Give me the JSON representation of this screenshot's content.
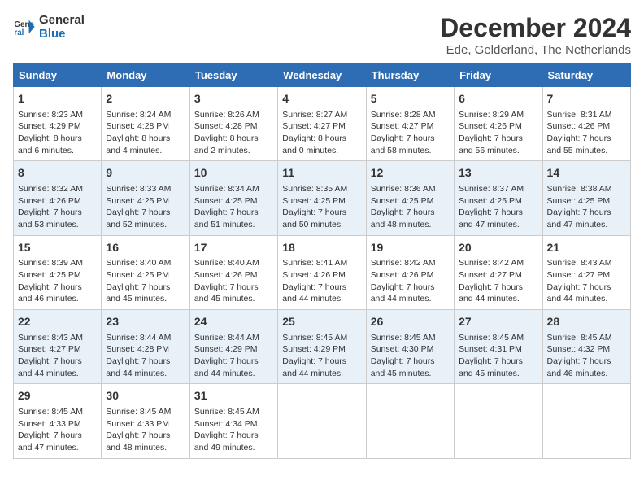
{
  "logo": {
    "line1": "General",
    "line2": "Blue"
  },
  "title": "December 2024",
  "subtitle": "Ede, Gelderland, The Netherlands",
  "columns": [
    "Sunday",
    "Monday",
    "Tuesday",
    "Wednesday",
    "Thursday",
    "Friday",
    "Saturday"
  ],
  "weeks": [
    [
      {
        "day": "1",
        "info": "Sunrise: 8:23 AM\nSunset: 4:29 PM\nDaylight: 8 hours\nand 6 minutes."
      },
      {
        "day": "2",
        "info": "Sunrise: 8:24 AM\nSunset: 4:28 PM\nDaylight: 8 hours\nand 4 minutes."
      },
      {
        "day": "3",
        "info": "Sunrise: 8:26 AM\nSunset: 4:28 PM\nDaylight: 8 hours\nand 2 minutes."
      },
      {
        "day": "4",
        "info": "Sunrise: 8:27 AM\nSunset: 4:27 PM\nDaylight: 8 hours\nand 0 minutes."
      },
      {
        "day": "5",
        "info": "Sunrise: 8:28 AM\nSunset: 4:27 PM\nDaylight: 7 hours\nand 58 minutes."
      },
      {
        "day": "6",
        "info": "Sunrise: 8:29 AM\nSunset: 4:26 PM\nDaylight: 7 hours\nand 56 minutes."
      },
      {
        "day": "7",
        "info": "Sunrise: 8:31 AM\nSunset: 4:26 PM\nDaylight: 7 hours\nand 55 minutes."
      }
    ],
    [
      {
        "day": "8",
        "info": "Sunrise: 8:32 AM\nSunset: 4:26 PM\nDaylight: 7 hours\nand 53 minutes."
      },
      {
        "day": "9",
        "info": "Sunrise: 8:33 AM\nSunset: 4:25 PM\nDaylight: 7 hours\nand 52 minutes."
      },
      {
        "day": "10",
        "info": "Sunrise: 8:34 AM\nSunset: 4:25 PM\nDaylight: 7 hours\nand 51 minutes."
      },
      {
        "day": "11",
        "info": "Sunrise: 8:35 AM\nSunset: 4:25 PM\nDaylight: 7 hours\nand 50 minutes."
      },
      {
        "day": "12",
        "info": "Sunrise: 8:36 AM\nSunset: 4:25 PM\nDaylight: 7 hours\nand 48 minutes."
      },
      {
        "day": "13",
        "info": "Sunrise: 8:37 AM\nSunset: 4:25 PM\nDaylight: 7 hours\nand 47 minutes."
      },
      {
        "day": "14",
        "info": "Sunrise: 8:38 AM\nSunset: 4:25 PM\nDaylight: 7 hours\nand 47 minutes."
      }
    ],
    [
      {
        "day": "15",
        "info": "Sunrise: 8:39 AM\nSunset: 4:25 PM\nDaylight: 7 hours\nand 46 minutes."
      },
      {
        "day": "16",
        "info": "Sunrise: 8:40 AM\nSunset: 4:25 PM\nDaylight: 7 hours\nand 45 minutes."
      },
      {
        "day": "17",
        "info": "Sunrise: 8:40 AM\nSunset: 4:26 PM\nDaylight: 7 hours\nand 45 minutes."
      },
      {
        "day": "18",
        "info": "Sunrise: 8:41 AM\nSunset: 4:26 PM\nDaylight: 7 hours\nand 44 minutes."
      },
      {
        "day": "19",
        "info": "Sunrise: 8:42 AM\nSunset: 4:26 PM\nDaylight: 7 hours\nand 44 minutes."
      },
      {
        "day": "20",
        "info": "Sunrise: 8:42 AM\nSunset: 4:27 PM\nDaylight: 7 hours\nand 44 minutes."
      },
      {
        "day": "21",
        "info": "Sunrise: 8:43 AM\nSunset: 4:27 PM\nDaylight: 7 hours\nand 44 minutes."
      }
    ],
    [
      {
        "day": "22",
        "info": "Sunrise: 8:43 AM\nSunset: 4:27 PM\nDaylight: 7 hours\nand 44 minutes."
      },
      {
        "day": "23",
        "info": "Sunrise: 8:44 AM\nSunset: 4:28 PM\nDaylight: 7 hours\nand 44 minutes."
      },
      {
        "day": "24",
        "info": "Sunrise: 8:44 AM\nSunset: 4:29 PM\nDaylight: 7 hours\nand 44 minutes."
      },
      {
        "day": "25",
        "info": "Sunrise: 8:45 AM\nSunset: 4:29 PM\nDaylight: 7 hours\nand 44 minutes."
      },
      {
        "day": "26",
        "info": "Sunrise: 8:45 AM\nSunset: 4:30 PM\nDaylight: 7 hours\nand 45 minutes."
      },
      {
        "day": "27",
        "info": "Sunrise: 8:45 AM\nSunset: 4:31 PM\nDaylight: 7 hours\nand 45 minutes."
      },
      {
        "day": "28",
        "info": "Sunrise: 8:45 AM\nSunset: 4:32 PM\nDaylight: 7 hours\nand 46 minutes."
      }
    ],
    [
      {
        "day": "29",
        "info": "Sunrise: 8:45 AM\nSunset: 4:33 PM\nDaylight: 7 hours\nand 47 minutes."
      },
      {
        "day": "30",
        "info": "Sunrise: 8:45 AM\nSunset: 4:33 PM\nDaylight: 7 hours\nand 48 minutes."
      },
      {
        "day": "31",
        "info": "Sunrise: 8:45 AM\nSunset: 4:34 PM\nDaylight: 7 hours\nand 49 minutes."
      },
      null,
      null,
      null,
      null
    ]
  ]
}
